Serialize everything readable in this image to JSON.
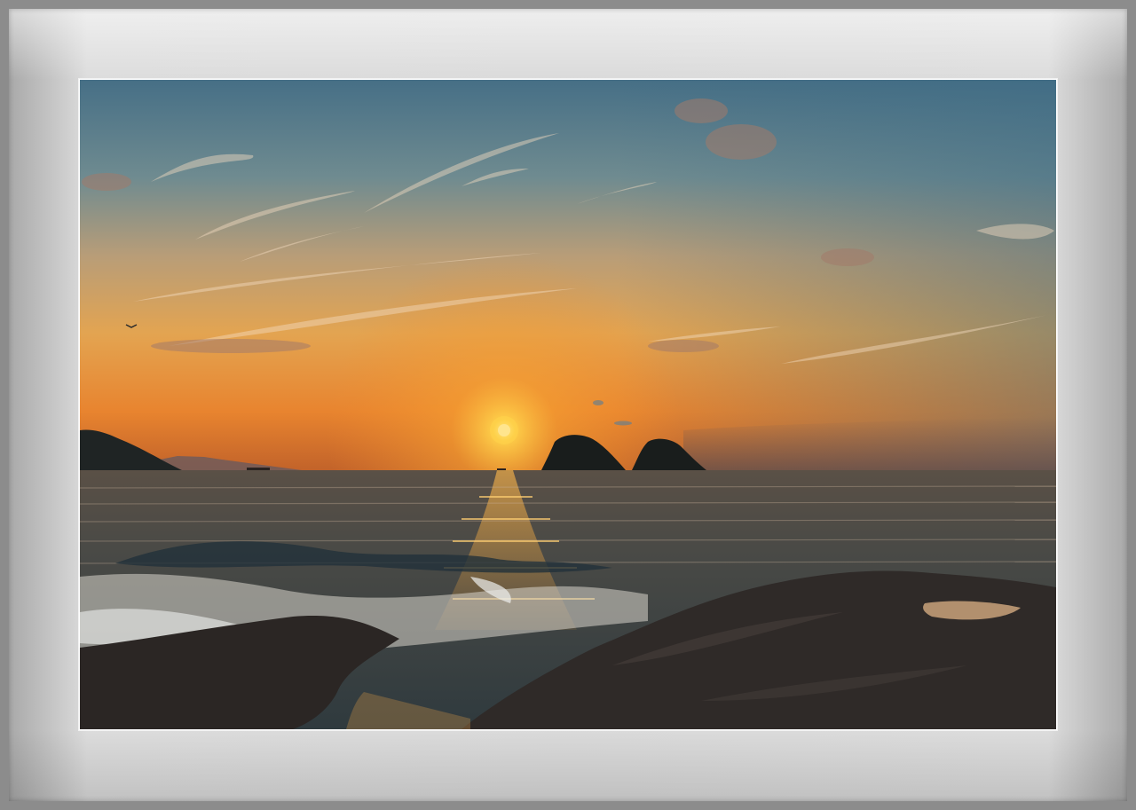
{
  "scene": {
    "sun": "sun-icon",
    "palette": {
      "sky_top": "#4a7389",
      "sky_mid": "#c9a175",
      "sky_glow": "#f2a43a",
      "horizon": "#e07a26",
      "sea": "#3d4a4f",
      "rock": "#2a2624",
      "frame": "#d9d9d9"
    }
  }
}
